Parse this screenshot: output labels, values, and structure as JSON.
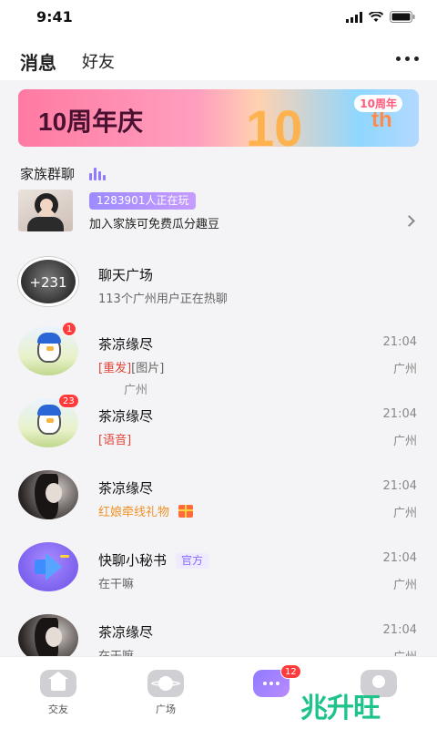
{
  "status_bar": {
    "time": "9:41"
  },
  "header": {
    "tabs": [
      {
        "label": "消息",
        "active": true
      },
      {
        "label": "好友",
        "active": false
      }
    ],
    "more_icon": "more-dots-icon"
  },
  "banner": {
    "title": "10周年庆",
    "big_text": "10",
    "suffix": "th",
    "logo": "10周年"
  },
  "family": {
    "section_label": "家族群聊",
    "online_count": "1283901人正在玩",
    "description": "加入家族可免费瓜分趣豆"
  },
  "conversations": [
    {
      "name": "聊天广场",
      "avatar_text": "+231",
      "subtitle": "113个广州用户正在热聊"
    },
    {
      "name": "茶凉缘尽",
      "time": "21:04",
      "location": "广州",
      "badge": "1",
      "sub_red": "[重发]",
      "sub_gray": "[图片]"
    },
    {
      "name": "茶凉缘尽",
      "time": "21:04",
      "location": "广州",
      "badge": "23",
      "sub_red": "[语音]"
    },
    {
      "name": "茶凉缘尽",
      "time": "21:04",
      "location": "广州",
      "sub_orange": "红娘牵线礼物"
    },
    {
      "name": "快聊小秘书",
      "tag": "官方",
      "time": "21:04",
      "location": "广州",
      "subtitle": "在干嘛"
    },
    {
      "name": "茶凉缘尽",
      "time": "21:04",
      "location": "广州",
      "subtitle": "在干嘛"
    }
  ],
  "floating_location": "广州",
  "tabbar": {
    "items": [
      {
        "label": "交友",
        "icon": "home-icon"
      },
      {
        "label": "广场",
        "icon": "planet-icon"
      },
      {
        "label": "",
        "icon": "chat-icon",
        "badge": "12"
      },
      {
        "label": "",
        "icon": "profile-icon"
      }
    ]
  },
  "watermark": "兆升旺",
  "colors": {
    "accent": "#8f7bff",
    "badge_red": "#ff3b3b",
    "red_text": "#e0453a",
    "orange_text": "#f0932b"
  }
}
